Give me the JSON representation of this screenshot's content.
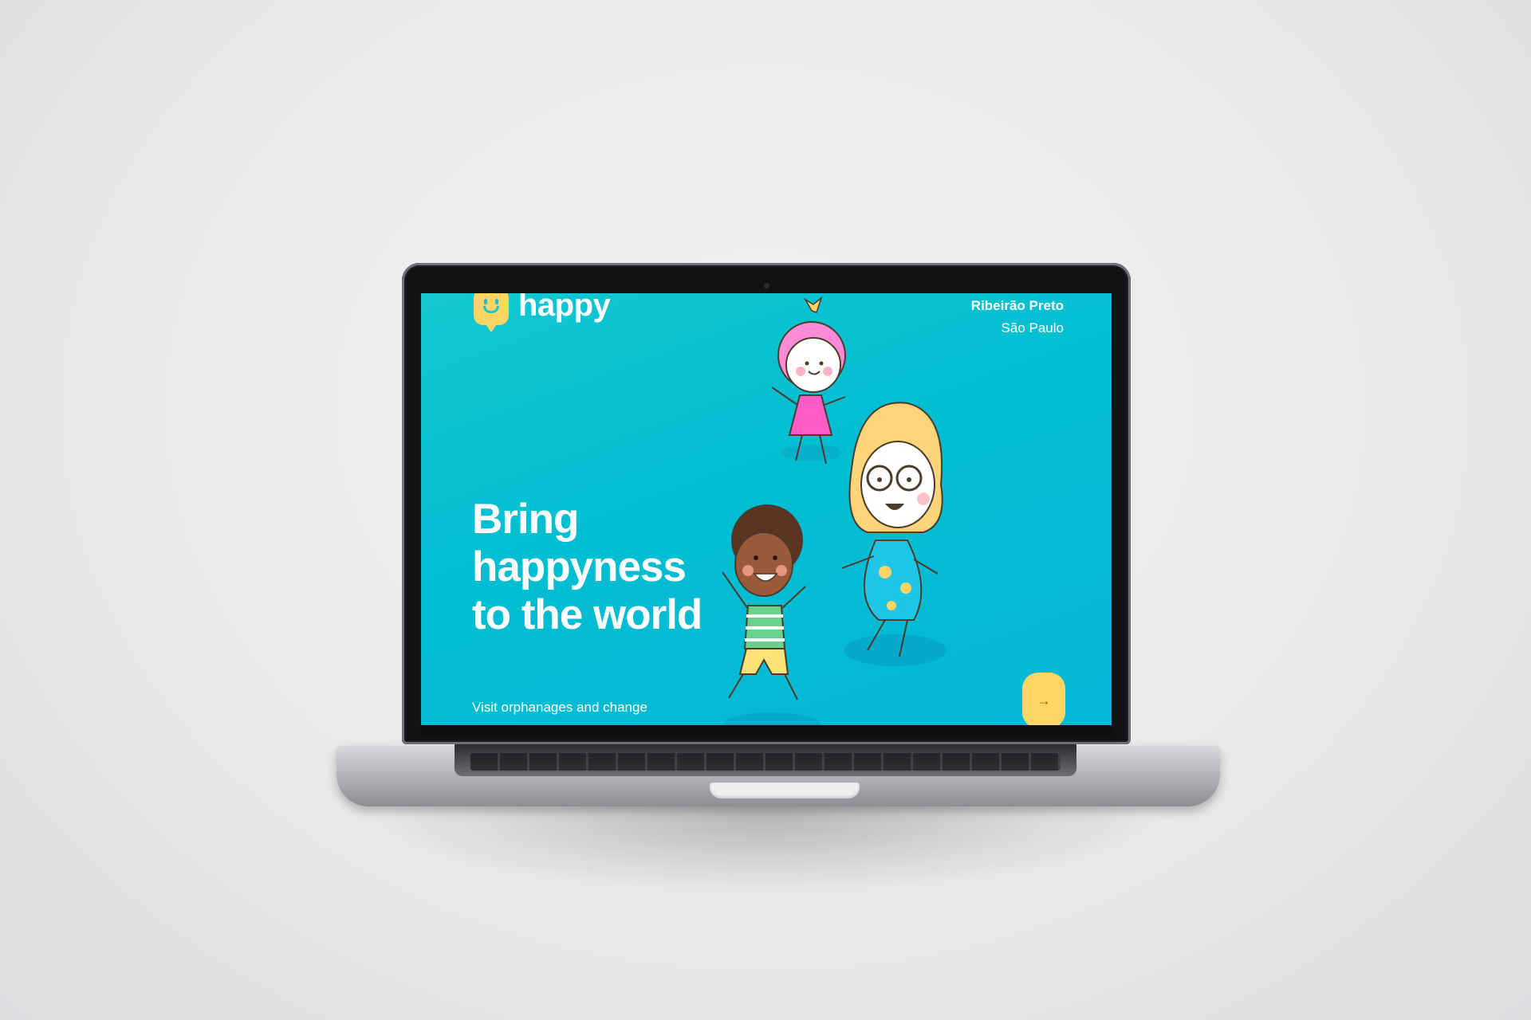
{
  "brand": {
    "name": "happy"
  },
  "location": {
    "city": "Ribeirão Preto",
    "state": "São Paulo"
  },
  "hero": {
    "headline": "Bring happyness to the world",
    "subtext": "Visit orphanages and change many children's day"
  },
  "icons": {
    "logo": "smiley-speech-bubble-icon",
    "enter": "arrow-right-icon",
    "enter_glyph": "→"
  },
  "colors": {
    "background_start": "#14c7d0",
    "background_end": "#05b6d6",
    "accent_yellow": "#ffd666",
    "text": "#ffffff"
  }
}
